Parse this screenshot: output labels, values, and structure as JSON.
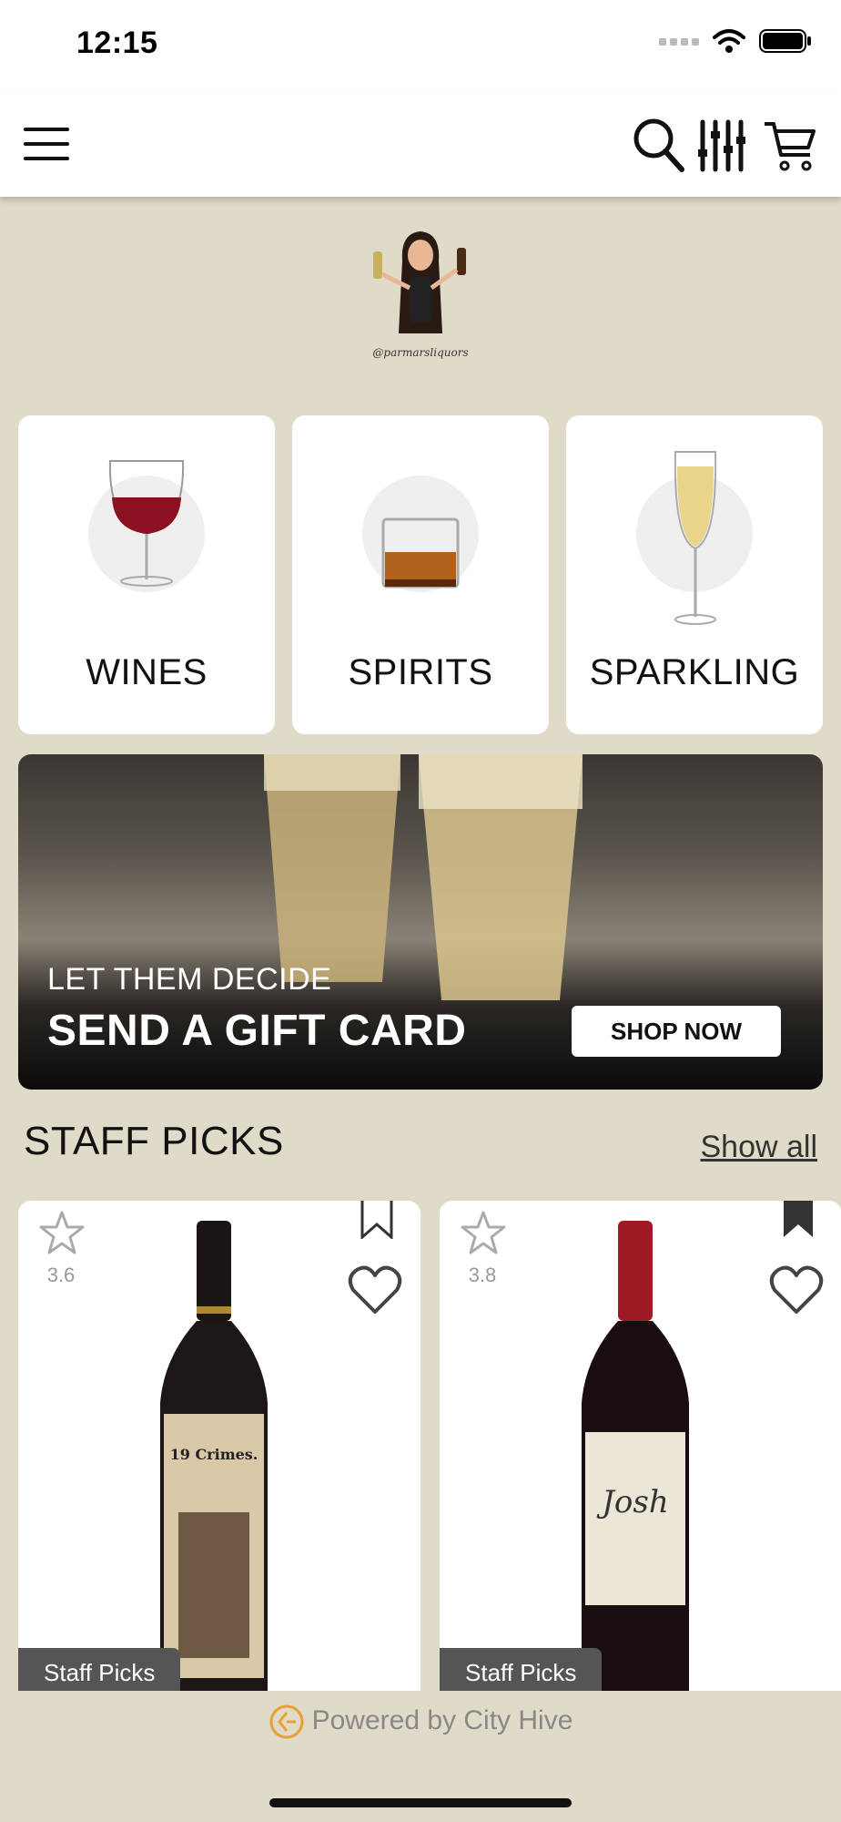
{
  "status_bar": {
    "time": "12:15"
  },
  "header": {
    "icons": [
      "menu-icon",
      "search-icon",
      "filter-icon",
      "cart-icon"
    ]
  },
  "logo": {
    "caption": "@parmarsliquors"
  },
  "categories": [
    {
      "label": "WINES",
      "icon": "wine-glass-icon"
    },
    {
      "label": "SPIRITS",
      "icon": "whiskey-glass-icon"
    },
    {
      "label": "SPARKLING",
      "icon": "champagne-flute-icon"
    }
  ],
  "banner": {
    "subtitle": "LET THEM DECIDE",
    "title": "SEND A GIFT CARD",
    "button": "SHOP NOW"
  },
  "staff_picks": {
    "title": "STAFF PICKS",
    "show_all": "Show all",
    "products": [
      {
        "rating": "3.6",
        "tag": "Staff Picks",
        "label_text": "19 Crimes.",
        "bookmarked": false
      },
      {
        "rating": "3.8",
        "tag": "Staff Picks",
        "label_text": "Josh",
        "bookmarked": true
      }
    ]
  },
  "footer": {
    "powered_by": "Powered by City Hive"
  },
  "colors": {
    "background": "#e0dbc8",
    "card": "#ffffff",
    "wine": "#8b1020",
    "accent": "#e8a030"
  }
}
